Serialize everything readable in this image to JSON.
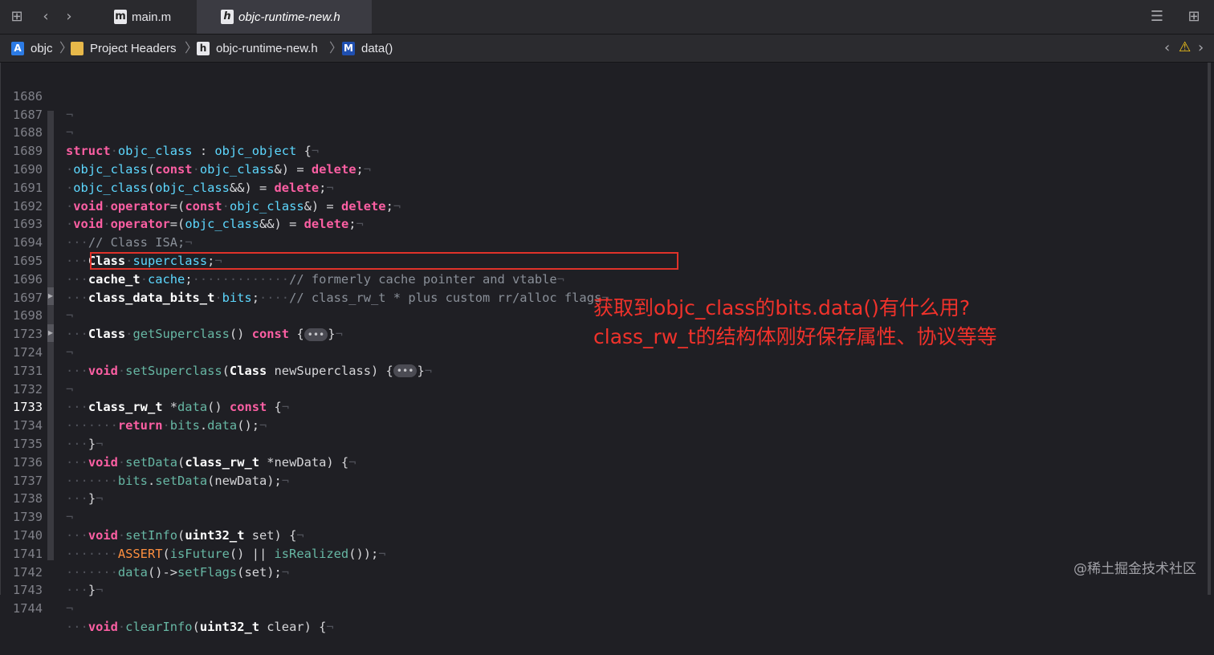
{
  "tabs": [
    {
      "label": "main.m",
      "icon": "m",
      "active": false
    },
    {
      "label": "objc-runtime-new.h",
      "icon": "h",
      "active": true
    }
  ],
  "breadcrumb": [
    {
      "label": "objc",
      "icon": "xcode-project-icon"
    },
    {
      "label": "Project Headers",
      "icon": "folder-icon"
    },
    {
      "label": "objc-runtime-new.h",
      "icon": "h"
    },
    {
      "label": "data()",
      "icon": "M"
    }
  ],
  "current_line": "1733",
  "annotation": {
    "line1": "获取到objc_class的bits.data()有什么用?",
    "line2": "class_rw_t的结构体刚好保存属性、协议等等"
  },
  "watermark": "@稀土掘金技术社区",
  "code_lines": [
    {
      "n": "1686"
    },
    {
      "n": "1687"
    },
    {
      "n": "1688"
    },
    {
      "n": "1689"
    },
    {
      "n": "1690"
    },
    {
      "n": "1691"
    },
    {
      "n": "1692"
    },
    {
      "n": "1693"
    },
    {
      "n": "1694"
    },
    {
      "n": "1695"
    },
    {
      "n": "1696"
    },
    {
      "n": "1697"
    },
    {
      "n": "1698"
    },
    {
      "n": "1723"
    },
    {
      "n": "1724"
    },
    {
      "n": "1731"
    },
    {
      "n": "1732"
    },
    {
      "n": "1733"
    },
    {
      "n": "1734"
    },
    {
      "n": "1735"
    },
    {
      "n": "1736"
    },
    {
      "n": "1737"
    },
    {
      "n": "1738"
    },
    {
      "n": "1739"
    },
    {
      "n": "1740"
    },
    {
      "n": "1741"
    },
    {
      "n": "1742"
    },
    {
      "n": "1743"
    },
    {
      "n": "1744"
    }
  ],
  "code": {
    "l1688": {
      "a": "struct",
      "b": "objc_class",
      "c": " : ",
      "d": "objc_object",
      "e": " {"
    },
    "l1689": {
      "a": "objc_class",
      "b": "(",
      "c": "const",
      "d": "objc_class",
      "e": "&) = ",
      "f": "delete",
      "g": ";"
    },
    "l1690": {
      "a": "objc_class",
      "b": "(",
      "c": "objc_class",
      "d": "&&) = ",
      "e": "delete",
      "f": ";"
    },
    "l1691": {
      "a": "void",
      "b": "operator",
      "c": "=(",
      "d": "const",
      "e": "objc_class",
      "f": "&) = ",
      "g": "delete",
      "h": ";"
    },
    "l1692": {
      "a": "void",
      "b": "operator",
      "c": "=(",
      "d": "objc_class",
      "e": "&&) = ",
      "f": "delete",
      "g": ";"
    },
    "l1693": {
      "a": "// Class ISA;"
    },
    "l1694": {
      "a": "Class",
      "b": "superclass",
      "c": ";"
    },
    "l1695": {
      "a": "cache_t",
      "b": "cache",
      "c": ";",
      "d": "// formerly cache pointer and vtable"
    },
    "l1696": {
      "a": "class_data_bits_t",
      "b": "bits",
      "c": ";",
      "d": "// class_rw_t * plus custom rr/alloc flags"
    },
    "l1698": {
      "a": "Class",
      "b": "getSuperclass",
      "c": "() ",
      "d": "const",
      "e": " {",
      "f": "•••",
      "g": "}"
    },
    "l1724": {
      "a": "void",
      "b": "setSuperclass",
      "c": "(",
      "d": "Class",
      "e": " newSuperclass) {",
      "f": "•••",
      "g": "}"
    },
    "l1732": {
      "a": "class_rw_t",
      "b": " *",
      "c": "data",
      "d": "() ",
      "e": "const",
      "f": " {"
    },
    "l1733": {
      "a": "return",
      "b": "bits",
      "c": ".",
      "d": "data",
      "e": "();"
    },
    "l1734": {
      "a": "}"
    },
    "l1735": {
      "a": "void",
      "b": "setData",
      "c": "(",
      "d": "class_rw_t",
      "e": " *newData) {"
    },
    "l1736": {
      "a": "bits",
      "b": ".",
      "c": "setData",
      "d": "(newData);"
    },
    "l1737": {
      "a": "}"
    },
    "l1739": {
      "a": "void",
      "b": "setInfo",
      "c": "(",
      "d": "uint32_t",
      "e": " set) {"
    },
    "l1740": {
      "a": "ASSERT",
      "b": "(",
      "c": "isFuture",
      "d": "() || ",
      "e": "isRealized",
      "f": "());"
    },
    "l1741": {
      "a": "data",
      "b": "()->",
      "c": "setFlags",
      "d": "(set);"
    },
    "l1742": {
      "a": "}"
    },
    "l1744": {
      "a": "void",
      "b": "clearInfo",
      "c": "(",
      "d": "uint32_t",
      "e": " clear) {"
    }
  },
  "colors": {
    "keyword": "#fc5fa3",
    "type": "#5dd8ff",
    "function": "#67b7a4",
    "comment": "#8a9099",
    "annotation": "#f0322b",
    "highlight_box": "#e0322a"
  }
}
